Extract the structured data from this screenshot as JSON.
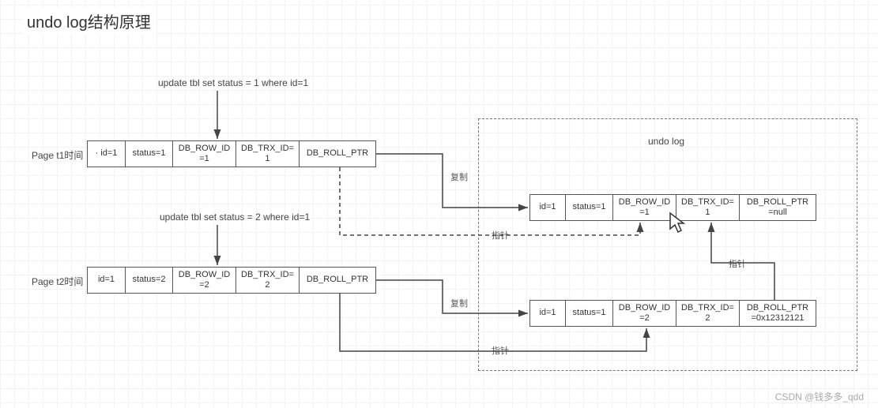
{
  "title": "undo log结构原理",
  "sql1": "update tbl set status = 1 where id=1",
  "sql2": "update tbl set status = 2 where id=1",
  "page_t1_label": "Page t1时间",
  "page_t2_label": "Page t2时间",
  "undo_log_title": "undo log",
  "row_t1": {
    "id": "· id=1",
    "status": "status=1",
    "row_id": "DB_ROW_ID\n=1",
    "trx_id": "DB_TRX_ID=\n1",
    "roll_ptr": "DB_ROLL_PTR"
  },
  "row_t2": {
    "id": "id=1",
    "status": "status=2",
    "row_id": "DB_ROW_ID\n=2",
    "trx_id": "DB_TRX_ID=\n2",
    "roll_ptr": "DB_ROLL_PTR"
  },
  "undo_row1": {
    "id": "id=1",
    "status": "status=1",
    "row_id": "DB_ROW_ID\n=1",
    "trx_id": "DB_TRX_ID=\n1",
    "roll_ptr": "DB_ROLL_PTR\n=null"
  },
  "undo_row2": {
    "id": "id=1",
    "status": "status=1",
    "row_id": "DB_ROW_ID\n=2",
    "trx_id": "DB_TRX_ID=\n2",
    "roll_ptr": "DB_ROLL_PTR\n=0x12312121"
  },
  "labels": {
    "copy": "复制",
    "pointer": "指针"
  },
  "watermark": "CSDN @钱多多_qdd"
}
